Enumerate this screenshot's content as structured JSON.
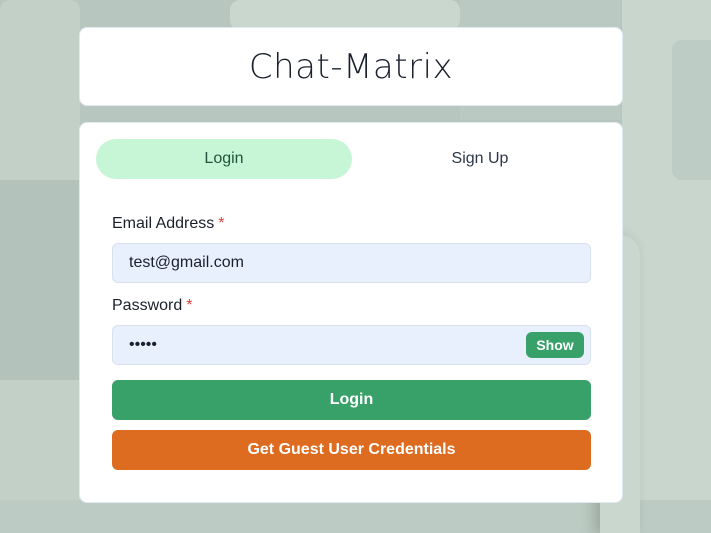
{
  "app": {
    "title": "Chat-Matrix"
  },
  "tabs": [
    {
      "label": "Login",
      "active": true
    },
    {
      "label": "Sign Up",
      "active": false
    }
  ],
  "form": {
    "email_label": "Email Address",
    "email_required_marker": "*",
    "email_value": "test@gmail.com",
    "password_label": "Password",
    "password_required_marker": "*",
    "password_masked_value": "•••••",
    "show_button_label": "Show"
  },
  "buttons": {
    "login_label": "Login",
    "guest_label": "Get Guest User Credentials"
  },
  "colors": {
    "accent_green": "#38a169",
    "active_tab_bg": "#c6f6d5",
    "guest_orange": "#dd6b20",
    "required_red": "#e53e3e",
    "input_bg": "#e8f0fe"
  }
}
